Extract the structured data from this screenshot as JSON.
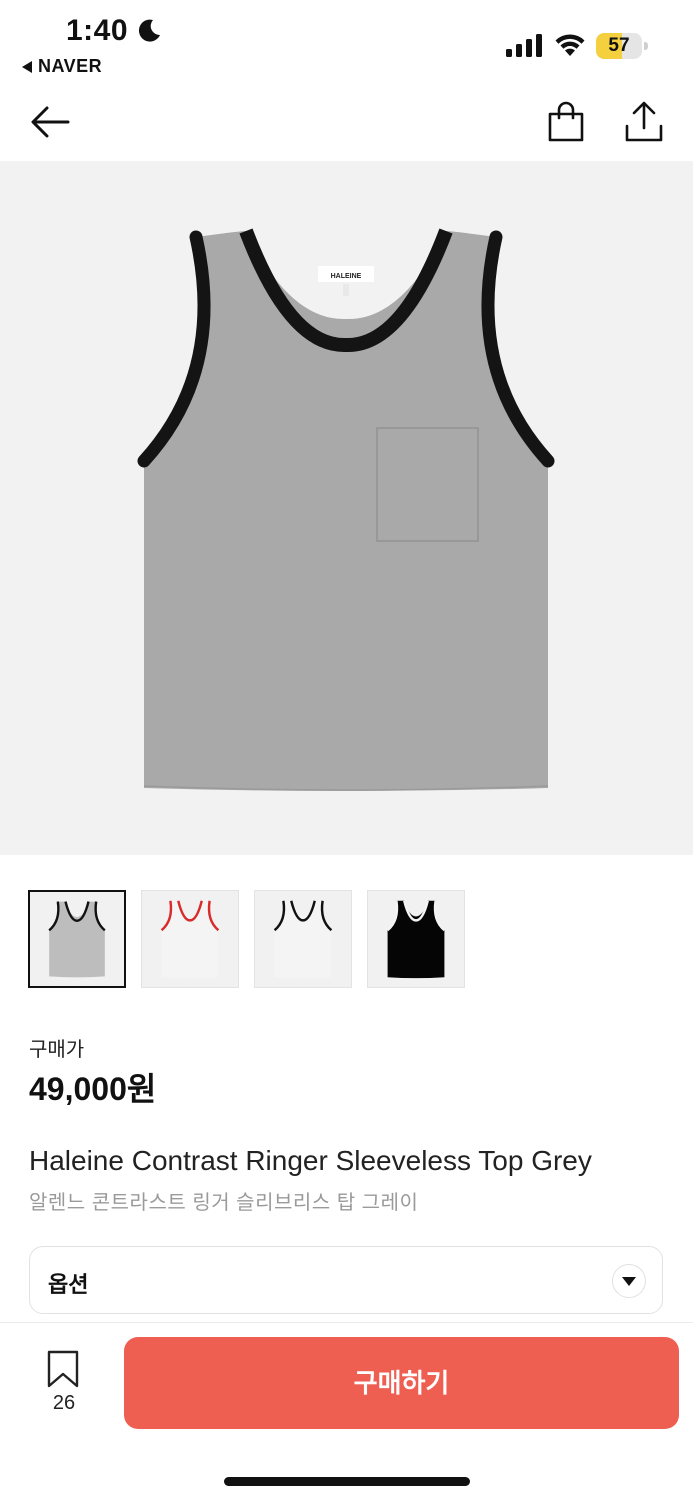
{
  "status_bar": {
    "time": "1:40",
    "back_app_label": "NAVER",
    "battery_percent": "57",
    "battery_level": 0.57
  },
  "icons": {
    "moon": "moon-icon",
    "signal": "cellular-signal-icon",
    "wifi": "wifi-icon",
    "back": "arrow-left-icon",
    "bag": "shopping-bag-icon",
    "share": "share-icon",
    "bookmark": "bookmark-icon",
    "dropdown": "chevron-down-icon"
  },
  "gallery": {
    "thumbnails": [
      {
        "color": "grey",
        "body": "#bdbdbd",
        "trim": "#111111",
        "selected": true
      },
      {
        "color": "white-red",
        "body": "#f4f4f4",
        "trim": "#d92b2b",
        "selected": false
      },
      {
        "color": "white-black",
        "body": "#f4f4f4",
        "trim": "#111111",
        "selected": false
      },
      {
        "color": "black",
        "body": "#050505",
        "trim": "#f4f4f4",
        "selected": false
      }
    ]
  },
  "product": {
    "price_label": "구매가",
    "price": "49,000원",
    "name_en": "Haleine Contrast Ringer Sleeveless Top Grey",
    "name_ko": "알렌느 콘트라스트 링거 슬리브리스 탑 그레이",
    "neck_label_text": "HALEINE"
  },
  "options": {
    "label": "옵션"
  },
  "bottom_bar": {
    "bookmark_count": "26",
    "buy_label": "구매하기",
    "accent_color": "#ee5f52"
  }
}
